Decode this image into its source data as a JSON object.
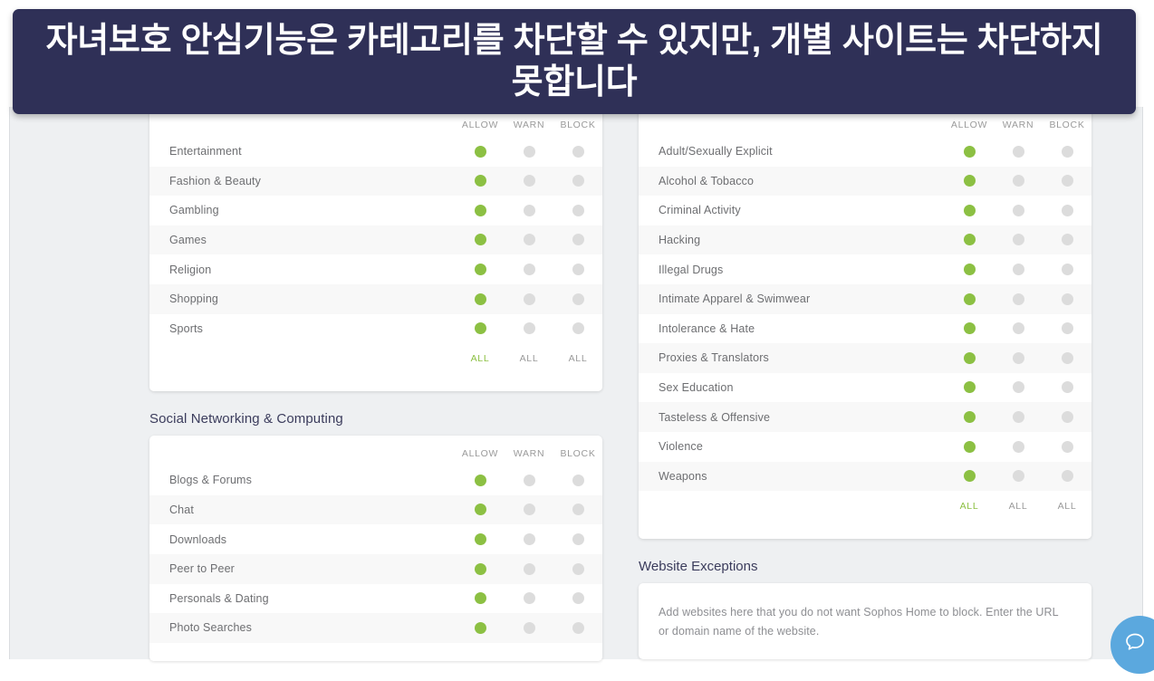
{
  "banner": {
    "text": "자녀보호 안심기능은 카테고리를 차단할 수 있지만, 개별 사이트는 차단하지 못합니다",
    "background_color": "#2f3057",
    "text_color": "#ffffff"
  },
  "colors": {
    "allow_green": "#8cc043",
    "inactive_gray": "#dcdcdc",
    "page_background": "#eef0f2",
    "card_background": "#ffffff",
    "heading_navy": "#3b3c5c",
    "support_blue": "#5ba8de"
  },
  "columns": {
    "headers": {
      "allow": "ALLOW",
      "warn": "WARN",
      "block": "BLOCK"
    },
    "all_label": "ALL"
  },
  "panels": [
    {
      "id": "general-interest",
      "column": "left",
      "title": "",
      "rows": [
        {
          "name": "Entertainment",
          "allow": true,
          "warn": false,
          "block": false
        },
        {
          "name": "Fashion & Beauty",
          "allow": true,
          "warn": false,
          "block": false
        },
        {
          "name": "Gambling",
          "allow": true,
          "warn": false,
          "block": false
        },
        {
          "name": "Games",
          "allow": true,
          "warn": false,
          "block": false
        },
        {
          "name": "Religion",
          "allow": true,
          "warn": false,
          "block": false
        },
        {
          "name": "Shopping",
          "allow": true,
          "warn": false,
          "block": false
        },
        {
          "name": "Sports",
          "allow": true,
          "warn": false,
          "block": false
        }
      ],
      "all_row": {
        "allow_active": true,
        "warn_active": false,
        "block_active": false
      }
    },
    {
      "id": "social-networking-computing",
      "column": "left",
      "title": "Social Networking & Computing",
      "rows": [
        {
          "name": "Blogs & Forums",
          "allow": true,
          "warn": false,
          "block": false
        },
        {
          "name": "Chat",
          "allow": true,
          "warn": false,
          "block": false
        },
        {
          "name": "Downloads",
          "allow": true,
          "warn": false,
          "block": false
        },
        {
          "name": "Peer to Peer",
          "allow": true,
          "warn": false,
          "block": false
        },
        {
          "name": "Personals & Dating",
          "allow": true,
          "warn": false,
          "block": false
        },
        {
          "name": "Photo Searches",
          "allow": true,
          "warn": false,
          "block": false
        }
      ],
      "all_row": null
    },
    {
      "id": "adult-risky",
      "column": "right",
      "title": "",
      "rows": [
        {
          "name": "Adult/Sexually Explicit",
          "allow": true,
          "warn": false,
          "block": false
        },
        {
          "name": "Alcohol & Tobacco",
          "allow": true,
          "warn": false,
          "block": false
        },
        {
          "name": "Criminal Activity",
          "allow": true,
          "warn": false,
          "block": false
        },
        {
          "name": "Hacking",
          "allow": true,
          "warn": false,
          "block": false
        },
        {
          "name": "Illegal Drugs",
          "allow": true,
          "warn": false,
          "block": false
        },
        {
          "name": "Intimate Apparel & Swimwear",
          "allow": true,
          "warn": false,
          "block": false
        },
        {
          "name": "Intolerance & Hate",
          "allow": true,
          "warn": false,
          "block": false
        },
        {
          "name": "Proxies & Translators",
          "allow": true,
          "warn": false,
          "block": false
        },
        {
          "name": "Sex Education",
          "allow": true,
          "warn": false,
          "block": false
        },
        {
          "name": "Tasteless & Offensive",
          "allow": true,
          "warn": false,
          "block": false
        },
        {
          "name": "Violence",
          "allow": true,
          "warn": false,
          "block": false
        },
        {
          "name": "Weapons",
          "allow": true,
          "warn": false,
          "block": false
        }
      ],
      "all_row": {
        "allow_active": true,
        "warn_active": false,
        "block_active": false
      }
    }
  ],
  "website_exceptions": {
    "title": "Website Exceptions",
    "hint": "Add websites here that you do not want Sophos Home to block. Enter the URL or domain name of the website."
  },
  "support": {
    "icon": "chat-bubble-icon"
  }
}
